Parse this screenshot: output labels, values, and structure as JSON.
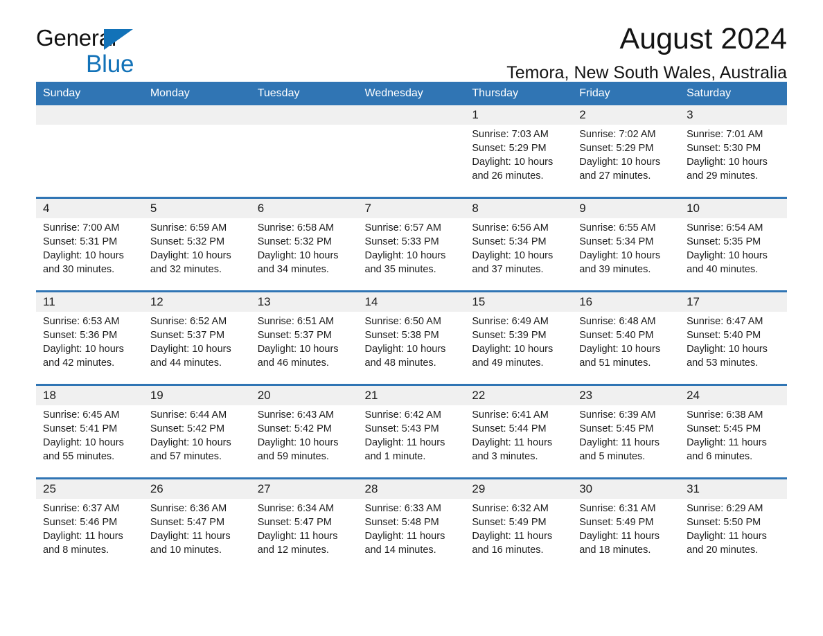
{
  "brand": {
    "word1": "General",
    "word2": "Blue",
    "triangle_color": "#1272b8",
    "icon": "triangle-icon"
  },
  "header": {
    "title": "August 2024",
    "location": "Temora, New South Wales, Australia"
  },
  "calendar": {
    "header_bg": "#3075b4",
    "header_text_color": "#ffffff",
    "daynum_band_bg": "#f0f0f0",
    "weekday_headers": [
      "Sunday",
      "Monday",
      "Tuesday",
      "Wednesday",
      "Thursday",
      "Friday",
      "Saturday"
    ],
    "weeks": [
      [
        {
          "day": "",
          "empty": true
        },
        {
          "day": "",
          "empty": true
        },
        {
          "day": "",
          "empty": true
        },
        {
          "day": "",
          "empty": true
        },
        {
          "day": "1",
          "sunrise": "Sunrise: 7:03 AM",
          "sunset": "Sunset: 5:29 PM",
          "daylight": "Daylight: 10 hours and 26 minutes."
        },
        {
          "day": "2",
          "sunrise": "Sunrise: 7:02 AM",
          "sunset": "Sunset: 5:29 PM",
          "daylight": "Daylight: 10 hours and 27 minutes."
        },
        {
          "day": "3",
          "sunrise": "Sunrise: 7:01 AM",
          "sunset": "Sunset: 5:30 PM",
          "daylight": "Daylight: 10 hours and 29 minutes."
        }
      ],
      [
        {
          "day": "4",
          "sunrise": "Sunrise: 7:00 AM",
          "sunset": "Sunset: 5:31 PM",
          "daylight": "Daylight: 10 hours and 30 minutes."
        },
        {
          "day": "5",
          "sunrise": "Sunrise: 6:59 AM",
          "sunset": "Sunset: 5:32 PM",
          "daylight": "Daylight: 10 hours and 32 minutes."
        },
        {
          "day": "6",
          "sunrise": "Sunrise: 6:58 AM",
          "sunset": "Sunset: 5:32 PM",
          "daylight": "Daylight: 10 hours and 34 minutes."
        },
        {
          "day": "7",
          "sunrise": "Sunrise: 6:57 AM",
          "sunset": "Sunset: 5:33 PM",
          "daylight": "Daylight: 10 hours and 35 minutes."
        },
        {
          "day": "8",
          "sunrise": "Sunrise: 6:56 AM",
          "sunset": "Sunset: 5:34 PM",
          "daylight": "Daylight: 10 hours and 37 minutes."
        },
        {
          "day": "9",
          "sunrise": "Sunrise: 6:55 AM",
          "sunset": "Sunset: 5:34 PM",
          "daylight": "Daylight: 10 hours and 39 minutes."
        },
        {
          "day": "10",
          "sunrise": "Sunrise: 6:54 AM",
          "sunset": "Sunset: 5:35 PM",
          "daylight": "Daylight: 10 hours and 40 minutes."
        }
      ],
      [
        {
          "day": "11",
          "sunrise": "Sunrise: 6:53 AM",
          "sunset": "Sunset: 5:36 PM",
          "daylight": "Daylight: 10 hours and 42 minutes."
        },
        {
          "day": "12",
          "sunrise": "Sunrise: 6:52 AM",
          "sunset": "Sunset: 5:37 PM",
          "daylight": "Daylight: 10 hours and 44 minutes."
        },
        {
          "day": "13",
          "sunrise": "Sunrise: 6:51 AM",
          "sunset": "Sunset: 5:37 PM",
          "daylight": "Daylight: 10 hours and 46 minutes."
        },
        {
          "day": "14",
          "sunrise": "Sunrise: 6:50 AM",
          "sunset": "Sunset: 5:38 PM",
          "daylight": "Daylight: 10 hours and 48 minutes."
        },
        {
          "day": "15",
          "sunrise": "Sunrise: 6:49 AM",
          "sunset": "Sunset: 5:39 PM",
          "daylight": "Daylight: 10 hours and 49 minutes."
        },
        {
          "day": "16",
          "sunrise": "Sunrise: 6:48 AM",
          "sunset": "Sunset: 5:40 PM",
          "daylight": "Daylight: 10 hours and 51 minutes."
        },
        {
          "day": "17",
          "sunrise": "Sunrise: 6:47 AM",
          "sunset": "Sunset: 5:40 PM",
          "daylight": "Daylight: 10 hours and 53 minutes."
        }
      ],
      [
        {
          "day": "18",
          "sunrise": "Sunrise: 6:45 AM",
          "sunset": "Sunset: 5:41 PM",
          "daylight": "Daylight: 10 hours and 55 minutes."
        },
        {
          "day": "19",
          "sunrise": "Sunrise: 6:44 AM",
          "sunset": "Sunset: 5:42 PM",
          "daylight": "Daylight: 10 hours and 57 minutes."
        },
        {
          "day": "20",
          "sunrise": "Sunrise: 6:43 AM",
          "sunset": "Sunset: 5:42 PM",
          "daylight": "Daylight: 10 hours and 59 minutes."
        },
        {
          "day": "21",
          "sunrise": "Sunrise: 6:42 AM",
          "sunset": "Sunset: 5:43 PM",
          "daylight": "Daylight: 11 hours and 1 minute."
        },
        {
          "day": "22",
          "sunrise": "Sunrise: 6:41 AM",
          "sunset": "Sunset: 5:44 PM",
          "daylight": "Daylight: 11 hours and 3 minutes."
        },
        {
          "day": "23",
          "sunrise": "Sunrise: 6:39 AM",
          "sunset": "Sunset: 5:45 PM",
          "daylight": "Daylight: 11 hours and 5 minutes."
        },
        {
          "day": "24",
          "sunrise": "Sunrise: 6:38 AM",
          "sunset": "Sunset: 5:45 PM",
          "daylight": "Daylight: 11 hours and 6 minutes."
        }
      ],
      [
        {
          "day": "25",
          "sunrise": "Sunrise: 6:37 AM",
          "sunset": "Sunset: 5:46 PM",
          "daylight": "Daylight: 11 hours and 8 minutes."
        },
        {
          "day": "26",
          "sunrise": "Sunrise: 6:36 AM",
          "sunset": "Sunset: 5:47 PM",
          "daylight": "Daylight: 11 hours and 10 minutes."
        },
        {
          "day": "27",
          "sunrise": "Sunrise: 6:34 AM",
          "sunset": "Sunset: 5:47 PM",
          "daylight": "Daylight: 11 hours and 12 minutes."
        },
        {
          "day": "28",
          "sunrise": "Sunrise: 6:33 AM",
          "sunset": "Sunset: 5:48 PM",
          "daylight": "Daylight: 11 hours and 14 minutes."
        },
        {
          "day": "29",
          "sunrise": "Sunrise: 6:32 AM",
          "sunset": "Sunset: 5:49 PM",
          "daylight": "Daylight: 11 hours and 16 minutes."
        },
        {
          "day": "30",
          "sunrise": "Sunrise: 6:31 AM",
          "sunset": "Sunset: 5:49 PM",
          "daylight": "Daylight: 11 hours and 18 minutes."
        },
        {
          "day": "31",
          "sunrise": "Sunrise: 6:29 AM",
          "sunset": "Sunset: 5:50 PM",
          "daylight": "Daylight: 11 hours and 20 minutes."
        }
      ]
    ]
  }
}
